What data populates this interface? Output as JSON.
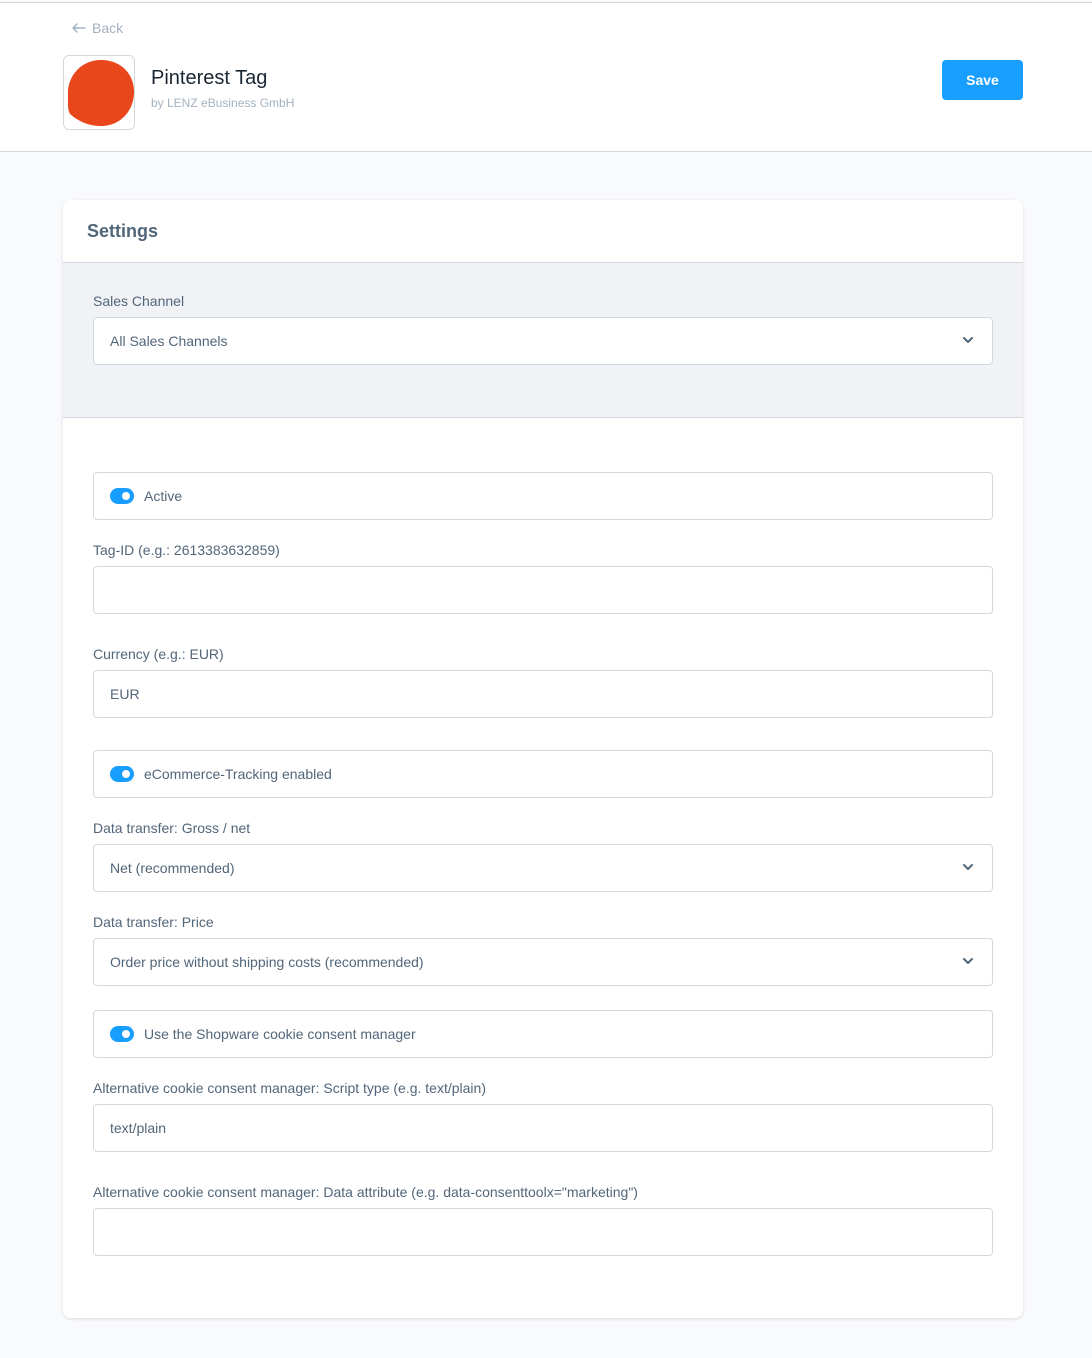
{
  "header": {
    "back_label": "Back",
    "app_title": "Pinterest Tag",
    "app_vendor": "by LENZ eBusiness GmbH",
    "save_label": "Save",
    "logo_color": "#e9471b"
  },
  "settings": {
    "title": "Settings",
    "sales_channel": {
      "label": "Sales Channel",
      "value": "All Sales Channels"
    },
    "active": {
      "label": "Active",
      "checked": true
    },
    "tag_id": {
      "label": "Tag-ID (e.g.: 2613383632859)",
      "value": ""
    },
    "currency": {
      "label": "Currency (e.g.: EUR)",
      "value": "EUR"
    },
    "ecommerce_tracking": {
      "label": "eCommerce-Tracking enabled",
      "checked": true
    },
    "gross_net": {
      "label": "Data transfer: Gross / net",
      "value": "Net (recommended)"
    },
    "price": {
      "label": "Data transfer: Price",
      "value": "Order price without shipping costs (recommended)"
    },
    "cookie_consent": {
      "label": "Use the Shopware cookie consent manager",
      "checked": true
    },
    "script_type": {
      "label": "Alternative cookie consent manager: Script type (e.g. text/plain)",
      "value": "text/plain"
    },
    "data_attribute": {
      "label": "Alternative cookie consent manager: Data attribute (e.g. data-consenttoolx=\"marketing\")",
      "value": ""
    }
  },
  "colors": {
    "accent": "#189eff",
    "text": "#52667a",
    "border": "#d1d9e0"
  }
}
